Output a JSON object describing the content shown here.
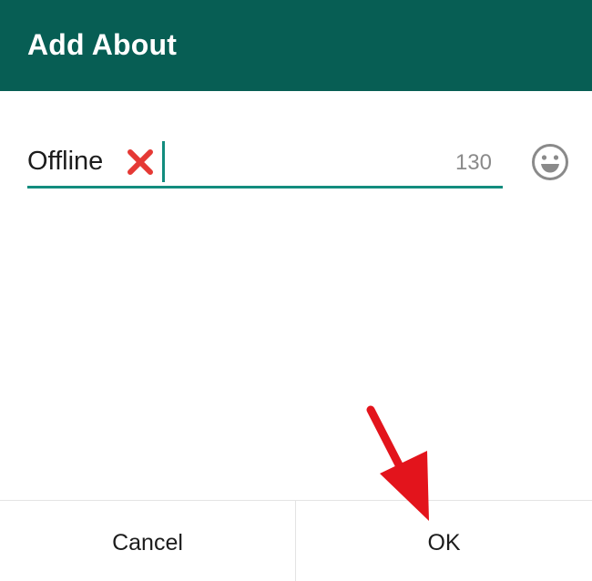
{
  "dialog": {
    "title": "Add About"
  },
  "input": {
    "value": "Offline",
    "counter": "130"
  },
  "icons": {
    "status_emoji": "cross-mark-icon",
    "emoji_picker": "smiley-face-icon",
    "annotation": "red-arrow-icon"
  },
  "buttons": {
    "cancel_label": "Cancel",
    "ok_label": "OK"
  },
  "colors": {
    "header": "#075e54",
    "accent": "#128c7e",
    "cross": "#e53935",
    "arrow": "#e3141c",
    "counter_text": "#8a8a8a"
  }
}
